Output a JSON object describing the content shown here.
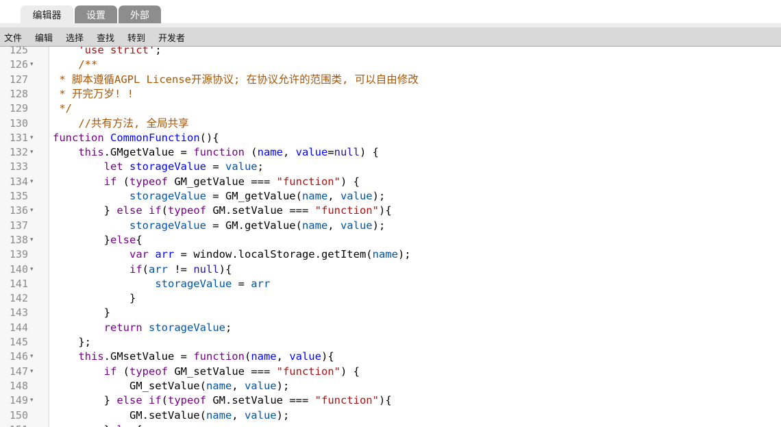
{
  "tabs": [
    {
      "label": "编辑器",
      "active": true
    },
    {
      "label": "设置",
      "active": false
    },
    {
      "label": "外部",
      "active": false
    }
  ],
  "menu": [
    "文件",
    "编辑",
    "选择",
    "查找",
    "转到",
    "开发者"
  ],
  "colors": {
    "keyword": "#770088",
    "definition": "#0000ff",
    "variable": "#0055aa",
    "string": "#aa1111",
    "comment": "#aa5500",
    "atom": "#221199",
    "line_number": "#8a8a8a",
    "menubar_bg": "#d9d9d9",
    "inactive_tab": "#8d8d8d"
  },
  "editor": {
    "lines": [
      {
        "n": "125",
        "fold": false,
        "tokens": [
          [
            "    ",
            ""
          ],
          [
            "'use strict'",
            "s"
          ],
          [
            ";",
            ""
          ]
        ]
      },
      {
        "n": "126",
        "fold": true,
        "tokens": [
          [
            "    ",
            ""
          ],
          [
            "/**",
            "c"
          ]
        ]
      },
      {
        "n": "127",
        "fold": false,
        "tokens": [
          [
            " * 脚本遵循AGPL License开源协议; 在协议允许的范围类, 可以自由修改",
            "c"
          ]
        ]
      },
      {
        "n": "128",
        "fold": false,
        "tokens": [
          [
            " * 开完万岁! !",
            "c"
          ]
        ]
      },
      {
        "n": "129",
        "fold": false,
        "tokens": [
          [
            " */",
            "c"
          ]
        ]
      },
      {
        "n": "130",
        "fold": false,
        "tokens": [
          [
            "    ",
            ""
          ],
          [
            "//共有方法, 全局共享",
            "c"
          ]
        ]
      },
      {
        "n": "131",
        "fold": true,
        "tokens": [
          [
            "function",
            "k"
          ],
          [
            " ",
            ""
          ],
          [
            "CommonFunction",
            "def"
          ],
          [
            "(){",
            ""
          ]
        ]
      },
      {
        "n": "132",
        "fold": true,
        "tokens": [
          [
            "    ",
            ""
          ],
          [
            "this",
            "k"
          ],
          [
            ".GMgetValue = ",
            ""
          ],
          [
            "function",
            "k"
          ],
          [
            " (",
            ""
          ],
          [
            "name",
            "def"
          ],
          [
            ", ",
            ""
          ],
          [
            "value",
            "def"
          ],
          [
            "=",
            ""
          ],
          [
            "null",
            "a"
          ],
          [
            ") {",
            ""
          ]
        ]
      },
      {
        "n": "133",
        "fold": false,
        "tokens": [
          [
            "        ",
            ""
          ],
          [
            "let",
            "k"
          ],
          [
            " ",
            ""
          ],
          [
            "storageValue",
            "def"
          ],
          [
            " = ",
            ""
          ],
          [
            "value",
            "v2"
          ],
          [
            ";",
            ""
          ]
        ]
      },
      {
        "n": "134",
        "fold": true,
        "tokens": [
          [
            "        ",
            ""
          ],
          [
            "if",
            "k"
          ],
          [
            " (",
            ""
          ],
          [
            "typeof",
            "k"
          ],
          [
            " GM_getValue === ",
            ""
          ],
          [
            "\"function\"",
            "s"
          ],
          [
            ") {",
            ""
          ]
        ]
      },
      {
        "n": "135",
        "fold": false,
        "tokens": [
          [
            "            ",
            ""
          ],
          [
            "storageValue",
            "v2"
          ],
          [
            " = GM_getValue(",
            ""
          ],
          [
            "name",
            "v2"
          ],
          [
            ", ",
            ""
          ],
          [
            "value",
            "v2"
          ],
          [
            ");",
            ""
          ]
        ]
      },
      {
        "n": "136",
        "fold": true,
        "tokens": [
          [
            "        } ",
            ""
          ],
          [
            "else",
            "k"
          ],
          [
            " ",
            ""
          ],
          [
            "if",
            "k"
          ],
          [
            "(",
            ""
          ],
          [
            "typeof",
            "k"
          ],
          [
            " GM.setValue === ",
            ""
          ],
          [
            "\"function\"",
            "s"
          ],
          [
            "){",
            ""
          ]
        ]
      },
      {
        "n": "137",
        "fold": false,
        "tokens": [
          [
            "            ",
            ""
          ],
          [
            "storageValue",
            "v2"
          ],
          [
            " = GM.getValue(",
            ""
          ],
          [
            "name",
            "v2"
          ],
          [
            ", ",
            ""
          ],
          [
            "value",
            "v2"
          ],
          [
            ");",
            ""
          ]
        ]
      },
      {
        "n": "138",
        "fold": true,
        "tokens": [
          [
            "        }",
            ""
          ],
          [
            "else",
            "k"
          ],
          [
            "{",
            ""
          ]
        ]
      },
      {
        "n": "139",
        "fold": false,
        "tokens": [
          [
            "            ",
            ""
          ],
          [
            "var",
            "k"
          ],
          [
            " ",
            ""
          ],
          [
            "arr",
            "def"
          ],
          [
            " = window.localStorage.getItem(",
            ""
          ],
          [
            "name",
            "v2"
          ],
          [
            ");",
            ""
          ]
        ]
      },
      {
        "n": "140",
        "fold": true,
        "tokens": [
          [
            "            ",
            ""
          ],
          [
            "if",
            "k"
          ],
          [
            "(",
            ""
          ],
          [
            "arr",
            "v2"
          ],
          [
            " != ",
            ""
          ],
          [
            "null",
            "a"
          ],
          [
            "){",
            ""
          ]
        ]
      },
      {
        "n": "141",
        "fold": false,
        "tokens": [
          [
            "                ",
            ""
          ],
          [
            "storageValue",
            "v2"
          ],
          [
            " = ",
            ""
          ],
          [
            "arr",
            "v2"
          ]
        ]
      },
      {
        "n": "142",
        "fold": false,
        "tokens": [
          [
            "            }",
            ""
          ]
        ]
      },
      {
        "n": "143",
        "fold": false,
        "tokens": [
          [
            "        }",
            ""
          ]
        ]
      },
      {
        "n": "144",
        "fold": false,
        "tokens": [
          [
            "        ",
            ""
          ],
          [
            "return",
            "k"
          ],
          [
            " ",
            ""
          ],
          [
            "storageValue",
            "v2"
          ],
          [
            ";",
            ""
          ]
        ]
      },
      {
        "n": "145",
        "fold": false,
        "tokens": [
          [
            "    };",
            ""
          ]
        ]
      },
      {
        "n": "146",
        "fold": true,
        "tokens": [
          [
            "    ",
            ""
          ],
          [
            "this",
            "k"
          ],
          [
            ".GMsetValue = ",
            ""
          ],
          [
            "function",
            "k"
          ],
          [
            "(",
            ""
          ],
          [
            "name",
            "def"
          ],
          [
            ", ",
            ""
          ],
          [
            "value",
            "def"
          ],
          [
            "){",
            ""
          ]
        ]
      },
      {
        "n": "147",
        "fold": true,
        "tokens": [
          [
            "        ",
            ""
          ],
          [
            "if",
            "k"
          ],
          [
            " (",
            ""
          ],
          [
            "typeof",
            "k"
          ],
          [
            " GM_setValue === ",
            ""
          ],
          [
            "\"function\"",
            "s"
          ],
          [
            ") {",
            ""
          ]
        ]
      },
      {
        "n": "148",
        "fold": false,
        "tokens": [
          [
            "            GM_setValue(",
            ""
          ],
          [
            "name",
            "v2"
          ],
          [
            ", ",
            ""
          ],
          [
            "value",
            "v2"
          ],
          [
            ");",
            ""
          ]
        ]
      },
      {
        "n": "149",
        "fold": true,
        "tokens": [
          [
            "        } ",
            ""
          ],
          [
            "else",
            "k"
          ],
          [
            " ",
            ""
          ],
          [
            "if",
            "k"
          ],
          [
            "(",
            ""
          ],
          [
            "typeof",
            "k"
          ],
          [
            " GM.setValue === ",
            ""
          ],
          [
            "\"function\"",
            "s"
          ],
          [
            "){",
            ""
          ]
        ]
      },
      {
        "n": "150",
        "fold": false,
        "tokens": [
          [
            "            GM.setValue(",
            ""
          ],
          [
            "name",
            "v2"
          ],
          [
            ", ",
            ""
          ],
          [
            "value",
            "v2"
          ],
          [
            ");",
            ""
          ]
        ]
      },
      {
        "n": "151",
        "fold": false,
        "tokens": [
          [
            "        }",
            ""
          ],
          [
            "else",
            "k"
          ],
          [
            "{",
            ""
          ]
        ]
      }
    ]
  }
}
